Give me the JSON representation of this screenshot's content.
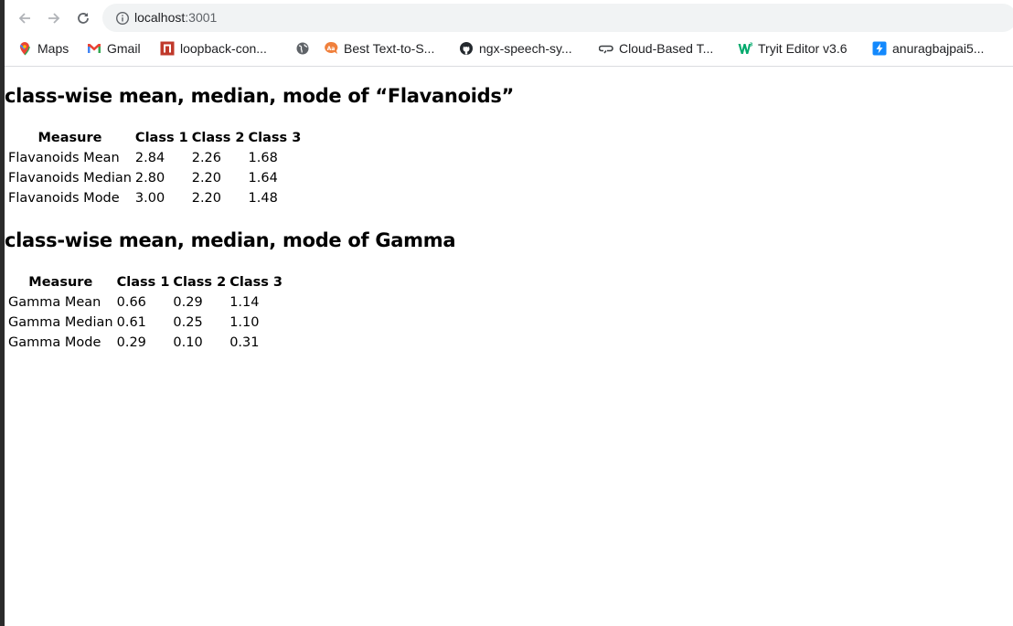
{
  "browser": {
    "url_host": "localhost",
    "url_port": ":3001",
    "bookmarks": [
      {
        "label": "Maps",
        "icon": "maps-pin-icon"
      },
      {
        "label": "Gmail",
        "icon": "gmail-icon"
      },
      {
        "label": "loopback-con...",
        "icon": "loopback-icon"
      },
      {
        "label": "",
        "icon": "globe-icon"
      },
      {
        "label": "Best Text-to-S...",
        "icon": "text-to-speech-icon"
      },
      {
        "label": "ngx-speech-sy...",
        "icon": "github-icon"
      },
      {
        "label": "Cloud-Based T...",
        "icon": "cloud-link-icon"
      },
      {
        "label": "Tryit Editor v3.6",
        "icon": "w3schools-icon"
      },
      {
        "label": "anuragbajpai5...",
        "icon": "lightning-icon"
      }
    ]
  },
  "sections": [
    {
      "title": "class-wise mean, median, mode of “Flavanoids”",
      "headers": [
        "Measure",
        "Class 1",
        "Class 2",
        "Class 3"
      ],
      "rows": [
        [
          "Flavanoids Mean",
          "2.84",
          "2.26",
          "1.68"
        ],
        [
          "Flavanoids Median",
          "2.80",
          "2.20",
          "1.64"
        ],
        [
          "Flavanoids Mode",
          "3.00",
          "2.20",
          "1.48"
        ]
      ]
    },
    {
      "title": "class-wise mean, median, mode of Gamma",
      "headers": [
        "Measure",
        "Class 1",
        "Class 2",
        "Class 3"
      ],
      "rows": [
        [
          "Gamma Mean",
          "0.66",
          "0.29",
          "1.14"
        ],
        [
          "Gamma Median",
          "0.61",
          "0.25",
          "1.10"
        ],
        [
          "Gamma Mode",
          "0.29",
          "0.10",
          "0.31"
        ]
      ]
    }
  ],
  "colors": {
    "omnibox_bg": "#f1f3f4",
    "icon_gray": "#5f6368",
    "text": "#000000"
  }
}
